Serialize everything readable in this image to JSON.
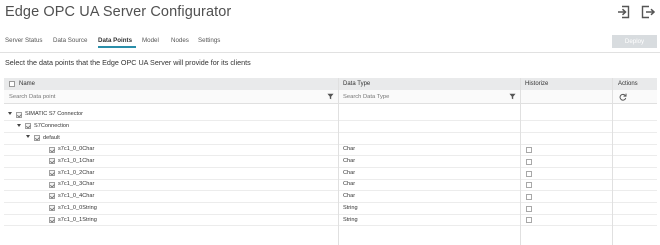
{
  "app": {
    "title": "Edge OPC UA Server Configurator",
    "icons": {
      "import": "import-icon",
      "exit": "exit-icon"
    },
    "accent_color": "#2a8ea9"
  },
  "nav": {
    "items": [
      "Server Status",
      "Data Source",
      "Data Points",
      "Model",
      "Nodes",
      "Settings"
    ],
    "active": "Data Points",
    "deploy_label": "Deploy"
  },
  "description": "Select the data points that the Edge OPC UA Server will provide for its clients",
  "table": {
    "headers": {
      "name": "Name",
      "data_type": "Data Type",
      "historize": "Historize",
      "actions": "Actions"
    },
    "filters": {
      "name_placeholder": "Search Data point",
      "type_placeholder": "Search Data Type"
    },
    "rows": [
      {
        "label": "SIMATIC S7 Connector",
        "type": "",
        "level": 0,
        "expand": true,
        "checkbox": true,
        "historize": false
      },
      {
        "label": "S7Connection",
        "type": "",
        "level": 1,
        "expand": true,
        "checkbox": true,
        "historize": false
      },
      {
        "label": "default",
        "type": "",
        "level": 2,
        "expand": true,
        "checkbox": true,
        "historize": false
      },
      {
        "label": "s7c1_0_0Char",
        "type": "Char",
        "level": 3,
        "expand": false,
        "checkbox": true,
        "historize": true
      },
      {
        "label": "s7c1_0_1Char",
        "type": "Char",
        "level": 3,
        "expand": false,
        "checkbox": true,
        "historize": true
      },
      {
        "label": "s7c1_0_2Char",
        "type": "Char",
        "level": 3,
        "expand": false,
        "checkbox": true,
        "historize": true
      },
      {
        "label": "s7c1_0_3Char",
        "type": "Char",
        "level": 3,
        "expand": false,
        "checkbox": true,
        "historize": true
      },
      {
        "label": "s7c1_0_4Char",
        "type": "Char",
        "level": 3,
        "expand": false,
        "checkbox": true,
        "historize": true
      },
      {
        "label": "s7c1_0_0String",
        "type": "String",
        "level": 3,
        "expand": false,
        "checkbox": true,
        "historize": true
      },
      {
        "label": "s7c1_0_1String",
        "type": "String",
        "level": 3,
        "expand": false,
        "checkbox": true,
        "historize": true
      }
    ]
  }
}
